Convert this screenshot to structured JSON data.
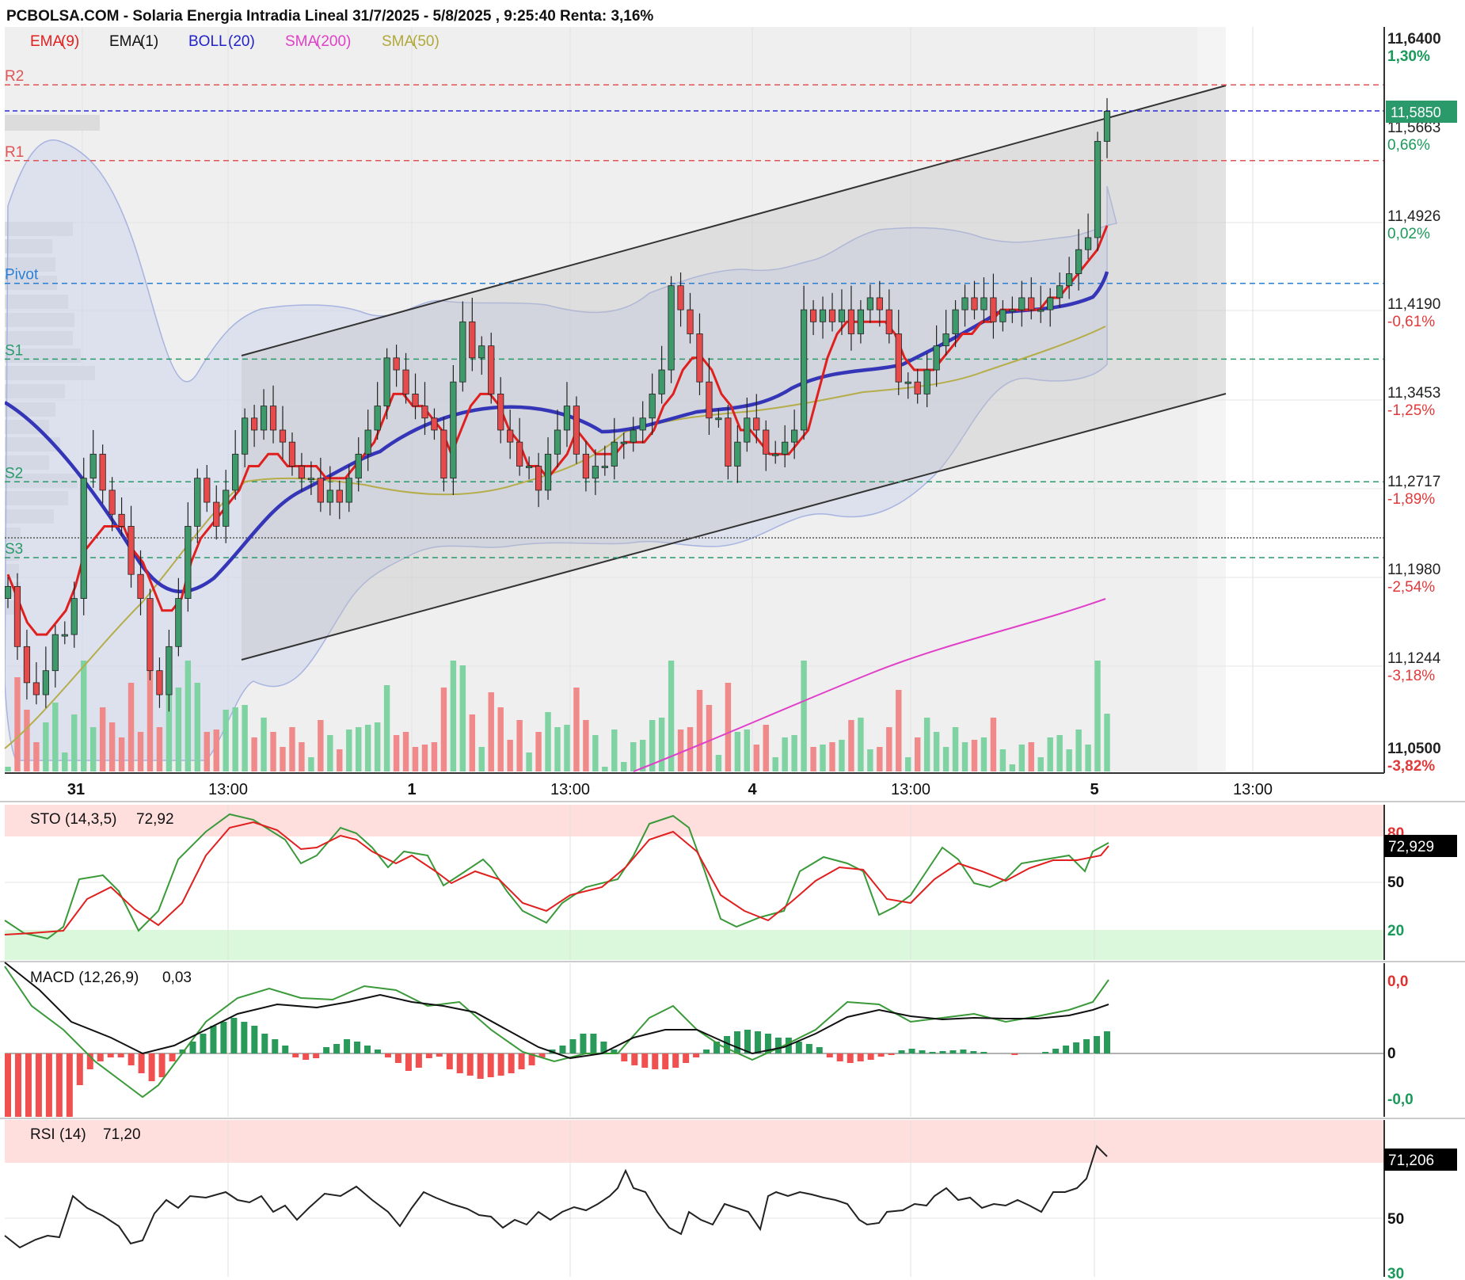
{
  "title": "PCBOLSA.COM - Solaria Energia Intradia Lineal 31/7/2025 - 5/8/2025 , 9:25:40 Renta: 3,16%",
  "indicators": [
    {
      "label": "EMA",
      "param": "(9)",
      "color": "#e0201f",
      "paramColor": "#e0201f"
    },
    {
      "label": "EMA",
      "param": "(1)",
      "color": "#111111",
      "paramColor": "#111111"
    },
    {
      "label": "BOLL",
      "param": "(20)",
      "color": "#2222c8",
      "paramColor": "#2222c8"
    },
    {
      "label": "SMA",
      "param": "(200)",
      "color": "#e040c8",
      "paramColor": "#e040c8"
    },
    {
      "label": "SMA",
      "param": "(50)",
      "color": "#b0a838",
      "paramColor": "#b0a838"
    }
  ],
  "levels": [
    {
      "name": "R2",
      "price": 11.607,
      "color": "#e05555"
    },
    {
      "name": "R1",
      "price": 11.544,
      "color": "#e05555"
    },
    {
      "name": "Pivot",
      "price": 11.442,
      "color": "#2a7fd4"
    },
    {
      "name": "S1",
      "price": 11.379,
      "color": "#2a9a6a"
    },
    {
      "name": "S2",
      "price": 11.277,
      "color": "#2a9a6a"
    },
    {
      "name": "S3",
      "price": 11.214,
      "color": "#2a9a6a"
    }
  ],
  "price_tag": "11,5850",
  "price_axis": [
    {
      "price": "11,6400",
      "pct": "1,30%",
      "pctColor": "#1a9a5a",
      "bold": true
    },
    {
      "price": "11,5663",
      "pct": "0,66%",
      "pctColor": "#1a9a5a",
      "bold": false
    },
    {
      "price": "11,4926",
      "pct": "0,02%",
      "pctColor": "#1a9a5a",
      "bold": false
    },
    {
      "price": "11,4190",
      "pct": "-0,61%",
      "pctColor": "#e03a3a",
      "bold": false
    },
    {
      "price": "11,3453",
      "pct": "-1,25%",
      "pctColor": "#e03a3a",
      "bold": false
    },
    {
      "price": "11,2717",
      "pct": "-1,89%",
      "pctColor": "#e03a3a",
      "bold": false
    },
    {
      "price": "11,1980",
      "pct": "-2,54%",
      "pctColor": "#e03a3a",
      "bold": false
    },
    {
      "price": "11,1244",
      "pct": "-3,18%",
      "pctColor": "#e03a3a",
      "bold": false
    },
    {
      "price": "11,0500",
      "pct": "-3,82%",
      "pctColor": "#e03a3a",
      "bold": true
    }
  ],
  "time_axis": [
    {
      "label": "31",
      "bold": true
    },
    {
      "label": "13:00",
      "bold": false
    },
    {
      "label": "1",
      "bold": true
    },
    {
      "label": "13:00",
      "bold": false
    },
    {
      "label": "4",
      "bold": true
    },
    {
      "label": "13:00",
      "bold": false
    },
    {
      "label": "5",
      "bold": true
    },
    {
      "label": "13:00",
      "bold": false
    }
  ],
  "sto": {
    "label": "STO (14,3,5)",
    "value": "72,92",
    "tag": "72,929",
    "axis": [
      "80",
      "50",
      "20"
    ]
  },
  "macd": {
    "label": "MACD (12,26,9)",
    "value": "0,03",
    "axis": [
      "0,0",
      "0",
      "-0,0"
    ]
  },
  "rsi": {
    "label": "RSI (14)",
    "value": "71,20",
    "tag": "71,206",
    "axis": [
      "50",
      "30"
    ]
  },
  "chart_data": {
    "type": "candlestick",
    "title": "PCBOLSA.COM - Solaria Energia Intradia Lineal 31/7/2025 - 5/8/2025 , 9:25:40 Renta: 3,16%",
    "ylim": [
      11.05,
      11.64
    ],
    "last_price": 11.585,
    "closes": [
      11.19,
      11.14,
      11.11,
      11.1,
      11.12,
      11.15,
      11.15,
      11.18,
      11.28,
      11.3,
      11.27,
      11.25,
      11.24,
      11.2,
      11.18,
      11.12,
      11.1,
      11.14,
      11.18,
      11.24,
      11.28,
      11.26,
      11.24,
      11.27,
      11.3,
      11.33,
      11.32,
      11.34,
      11.32,
      11.31,
      11.29,
      11.28,
      11.28,
      11.26,
      11.27,
      11.26,
      11.28,
      11.3,
      11.32,
      11.34,
      11.38,
      11.37,
      11.35,
      11.34,
      11.33,
      11.32,
      11.28,
      11.36,
      11.41,
      11.38,
      11.39,
      11.35,
      11.32,
      11.31,
      11.29,
      11.29,
      11.27,
      11.3,
      11.32,
      11.34,
      11.3,
      11.28,
      11.29,
      11.29,
      11.31,
      11.31,
      11.32,
      11.33,
      11.35,
      11.37,
      11.44,
      11.42,
      11.4,
      11.36,
      11.33,
      11.33,
      11.29,
      11.31,
      11.33,
      11.32,
      11.3,
      11.3,
      11.31,
      11.32,
      11.42,
      11.41,
      11.42,
      11.41,
      11.42,
      11.4,
      11.42,
      11.43,
      11.42,
      11.4,
      11.36,
      11.36,
      11.35,
      11.37,
      11.39,
      11.4,
      11.42,
      11.43,
      11.42,
      11.43,
      11.41,
      11.42,
      11.42,
      11.43,
      11.42,
      11.42,
      11.43,
      11.44,
      11.45,
      11.47,
      11.48,
      11.56,
      11.585
    ],
    "ema9": [
      11.2,
      11.18,
      11.16,
      11.15,
      11.15,
      11.16,
      11.17,
      11.19,
      11.22,
      11.23,
      11.24,
      11.24,
      11.24,
      11.22,
      11.21,
      11.19,
      11.17,
      11.17,
      11.18,
      11.21,
      11.23,
      11.24,
      11.25,
      11.26,
      11.27,
      11.29,
      11.29,
      11.3,
      11.3,
      11.29,
      11.29,
      11.29,
      11.29,
      11.28,
      11.28,
      11.28,
      11.29,
      11.3,
      11.31,
      11.33,
      11.35,
      11.35,
      11.34,
      11.34,
      11.33,
      11.32,
      11.3,
      11.32,
      11.34,
      11.35,
      11.35,
      11.34,
      11.32,
      11.31,
      11.29,
      11.29,
      11.28,
      11.29,
      11.3,
      11.32,
      11.31,
      11.3,
      11.3,
      11.3,
      11.31,
      11.31,
      11.31,
      11.32,
      11.34,
      11.35,
      11.37,
      11.38,
      11.38,
      11.37,
      11.35,
      11.34,
      11.32,
      11.32,
      11.31,
      11.3,
      11.3,
      11.3,
      11.31,
      11.32,
      11.35,
      11.38,
      11.4,
      11.41,
      11.41,
      11.41,
      11.41,
      11.41,
      11.4,
      11.38,
      11.37,
      11.37,
      11.37,
      11.38,
      11.39,
      11.4,
      11.4,
      11.41,
      11.41,
      11.42,
      11.42,
      11.42,
      11.42,
      11.42,
      11.43,
      11.43,
      11.44,
      11.45,
      11.46,
      11.47,
      11.49
    ]
  }
}
